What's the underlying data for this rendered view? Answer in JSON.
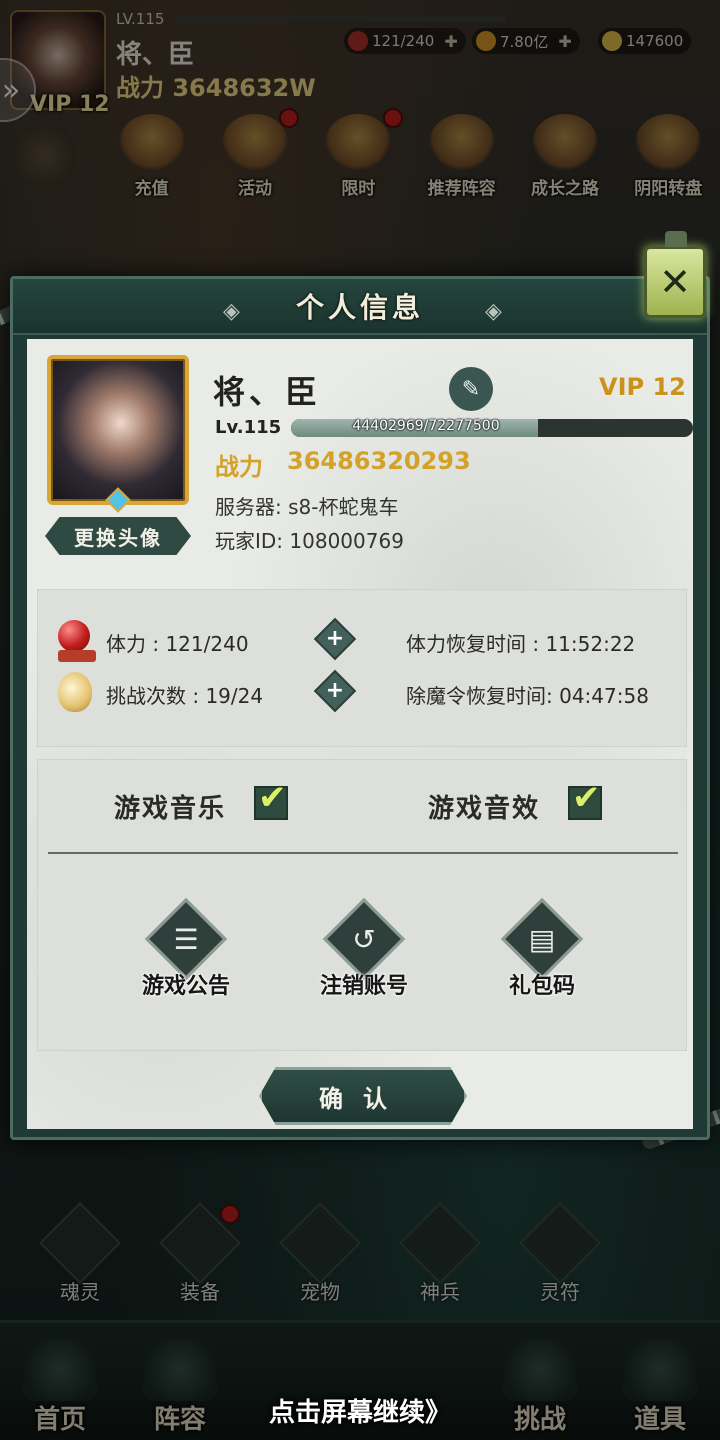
{
  "topbar": {
    "level": "LV.115",
    "name": "将、臣",
    "power": "战力 3648632W",
    "vip": "VIP 12",
    "stamina": "121/240",
    "gold": "7.80亿",
    "gems": "147600"
  },
  "top_menu": [
    {
      "label": "充值",
      "dot": false
    },
    {
      "label": "活动",
      "dot": true
    },
    {
      "label": "限时",
      "dot": true
    },
    {
      "label": "推荐阵容",
      "dot": false
    },
    {
      "label": "成长之路",
      "dot": false
    },
    {
      "label": "阴阳转盘",
      "dot": false
    }
  ],
  "dialog": {
    "title": "个人信息",
    "close_symbol": "✕",
    "profile": {
      "name": "将、臣",
      "vip": "VIP 12",
      "level_label": "Lv.115",
      "exp_text": "44402969/72277500",
      "exp_current": 44402969,
      "exp_max": 72277500,
      "power_label": "战力",
      "power_value": "36486320293",
      "server": "服务器: s8-杯蛇鬼车",
      "player_id": "玩家ID:  108000769",
      "change_avatar": "更换头像"
    },
    "stats": {
      "stamina": "体力 : 121/240",
      "stamina_recover": "体力恢复时间 : 11:52:22",
      "challenges": "挑战次数 : 19/24",
      "token_recover": "除魔令恢复时间: 04:47:58"
    },
    "settings": {
      "music_label": "游戏音乐",
      "music_on": true,
      "sfx_label": "游戏音效",
      "sfx_on": true
    },
    "functions": {
      "notice": "游戏公告",
      "logout": "注销账号",
      "gift_code": "礼包码"
    },
    "confirm": "确认"
  },
  "bottom_menu": [
    "魂灵",
    "装备",
    "宠物",
    "神兵",
    "灵符"
  ],
  "nav": [
    "首页",
    "阵容",
    "挑战",
    "道具"
  ],
  "continue_hint": "点击屏幕继续》"
}
